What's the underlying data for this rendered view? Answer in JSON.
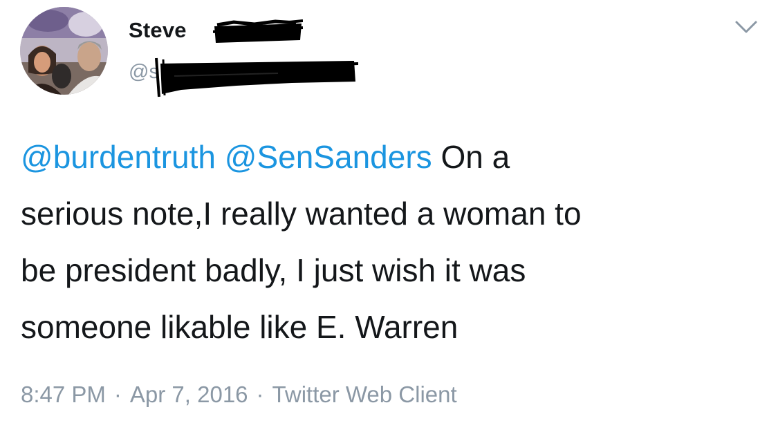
{
  "author": {
    "display_name_visible": "Steve",
    "handle_visible": "@s",
    "avatar_icon": "profile-photo"
  },
  "menu_icon": "chevron-down-icon",
  "tweet": {
    "mentions": [
      "@burdentruth",
      "@SenSanders"
    ],
    "line1_text": "On a",
    "line2": "serious note,I really wanted a woman to",
    "line3": "be president badly, I just wish it was",
    "line4": "someone likable like E. Warren"
  },
  "meta": {
    "time": "8:47 PM",
    "separator": "·",
    "date": "Apr 7, 2016",
    "client": "Twitter Web Client"
  },
  "colors": {
    "text": "#14171a",
    "link": "#1b95e0",
    "muted": "#8b98a5",
    "redaction": "#000000"
  }
}
